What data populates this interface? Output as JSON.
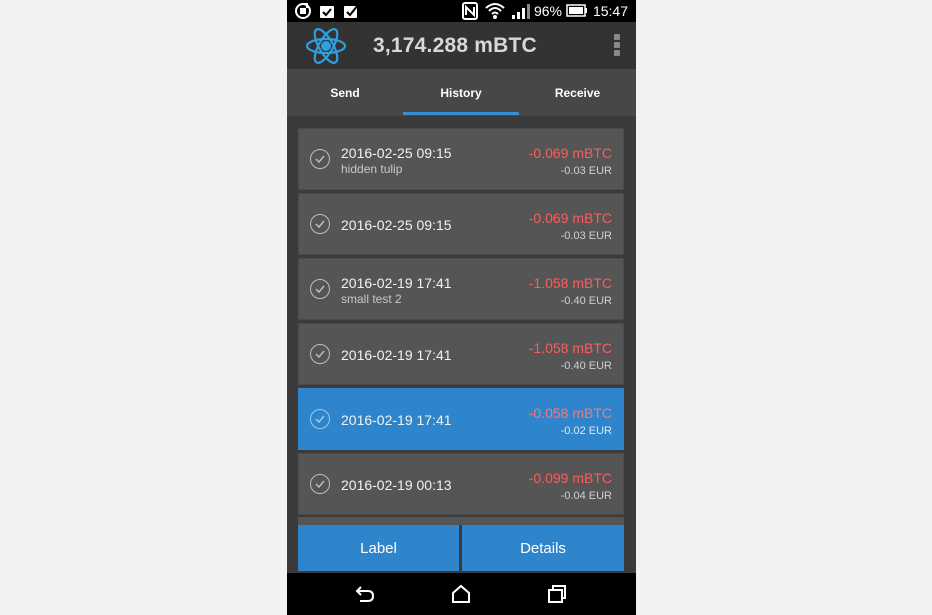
{
  "status_bar": {
    "battery_percent": "96%",
    "time": "15:47"
  },
  "app_bar": {
    "balance": "3,174.288 mBTC"
  },
  "tabs": [
    {
      "label": "Send"
    },
    {
      "label": "History",
      "active": true
    },
    {
      "label": "Receive"
    }
  ],
  "transactions": [
    {
      "date": "2016-02-25 09:15",
      "label": "hidden tulip",
      "amount": "-0.069 mBTC",
      "fiat": "-0.03 EUR"
    },
    {
      "date": "2016-02-25 09:15",
      "label": "",
      "amount": "-0.069 mBTC",
      "fiat": "-0.03 EUR"
    },
    {
      "date": "2016-02-19 17:41",
      "label": "small test 2",
      "amount": "-1.058 mBTC",
      "fiat": "-0.40 EUR"
    },
    {
      "date": "2016-02-19 17:41",
      "label": "",
      "amount": "-1.058 mBTC",
      "fiat": "-0.40 EUR"
    },
    {
      "date": "2016-02-19 17:41",
      "label": "",
      "amount": "-0.058 mBTC",
      "fiat": "-0.02 EUR",
      "selected": true
    },
    {
      "date": "2016-02-19 00:13",
      "label": "",
      "amount": "-0.099 mBTC",
      "fiat": "-0.04 EUR"
    }
  ],
  "actions": {
    "label_button": "Label",
    "details_button": "Details"
  },
  "colors": {
    "accent": "#2f85cc",
    "negative_amount": "#ff5b5b",
    "row_background": "#555555"
  }
}
